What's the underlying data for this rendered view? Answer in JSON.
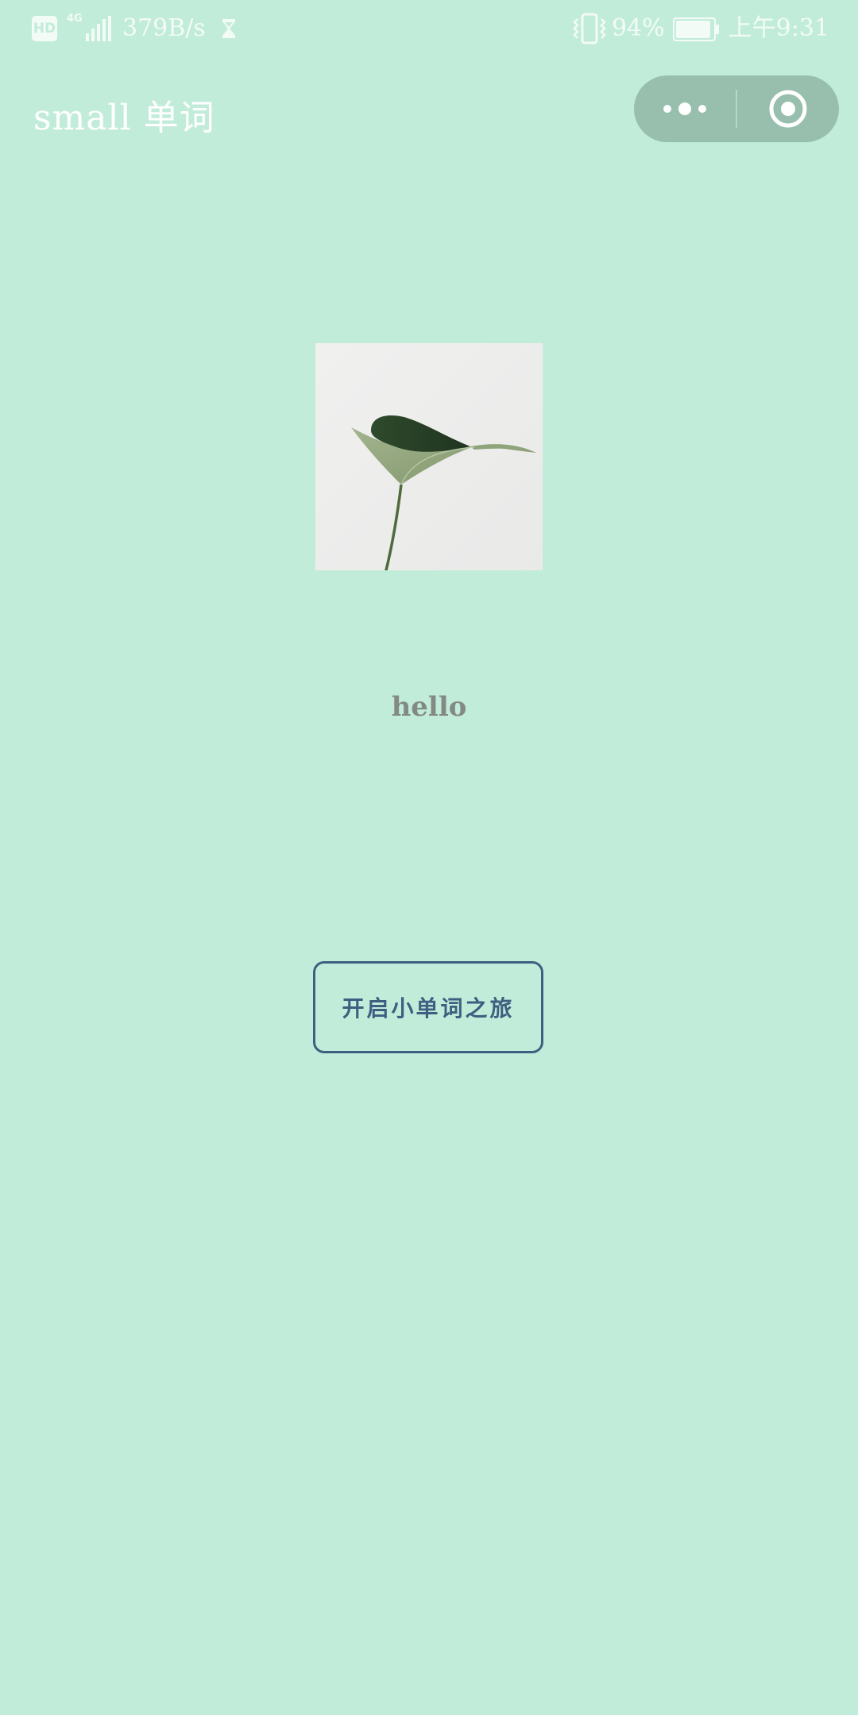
{
  "status_bar": {
    "hd_label": "HD",
    "network_type": "4G",
    "speed": "379B/s",
    "battery_percent": "94%",
    "battery_level": 0.94,
    "time": "上午9:31",
    "icons": [
      "hd-icon",
      "signal-icon",
      "hourglass-icon",
      "vibrate-icon",
      "battery-icon"
    ]
  },
  "nav": {
    "title": "small 单词",
    "capsule_icons": [
      "more-icon",
      "close-target-icon"
    ]
  },
  "main": {
    "image_description_icon": "leaf-image",
    "greeting": "hello",
    "start_button_label": "开启小单词之旅"
  },
  "colors": {
    "background": "#c2ecda",
    "capsule": "#98bfad",
    "button_border": "#3e5f80",
    "greeting_text": "#838a85"
  }
}
